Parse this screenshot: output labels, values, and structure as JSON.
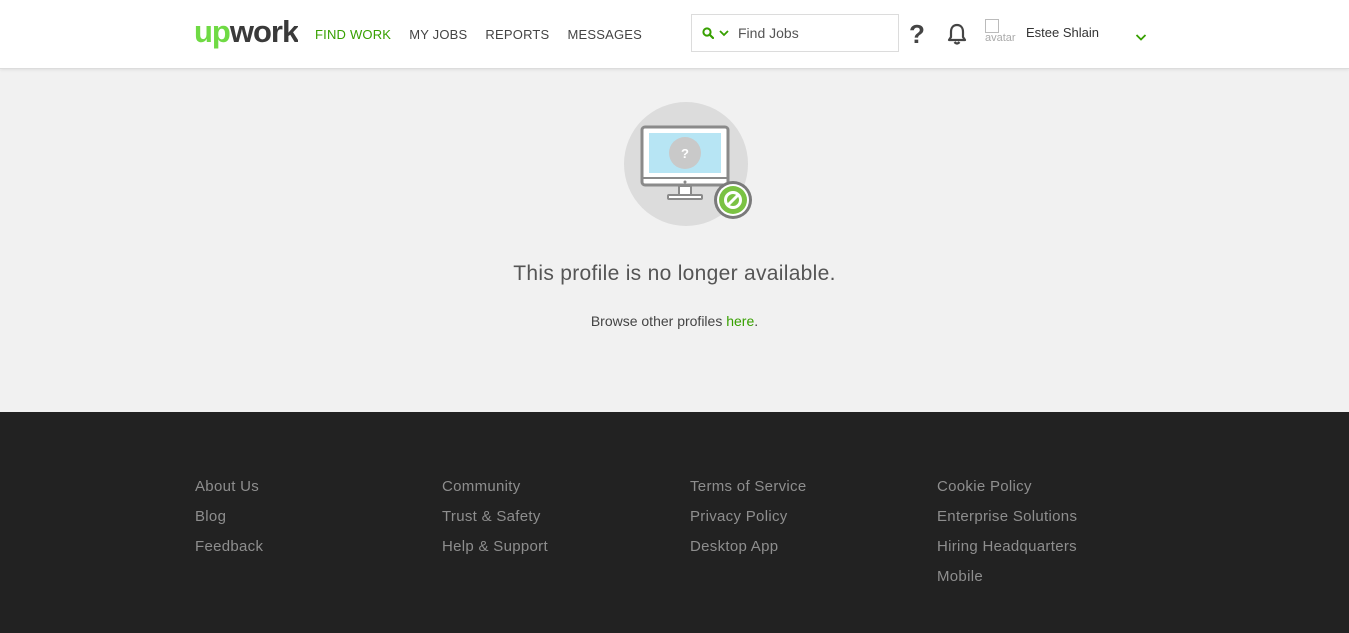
{
  "brand": {
    "logo_text": "upwork",
    "accent": "#37a000"
  },
  "nav": {
    "items": [
      {
        "label": "FIND WORK",
        "active": true
      },
      {
        "label": "MY JOBS"
      },
      {
        "label": "REPORTS"
      },
      {
        "label": "MESSAGES"
      }
    ]
  },
  "search": {
    "placeholder": "Find Jobs",
    "value": "",
    "icon": "search-icon"
  },
  "header": {
    "help_label": "?",
    "avatar_alt": "avatar",
    "user_name": "Estee Shlain"
  },
  "main": {
    "message": "This profile is no longer available.",
    "browse_prefix": "Browse other profiles ",
    "browse_link": "here",
    "browse_suffix": "."
  },
  "footer": {
    "columns": [
      [
        "About Us",
        "Blog",
        "Feedback"
      ],
      [
        "Community",
        "Trust & Safety",
        "Help & Support"
      ],
      [
        "Terms of Service",
        "Privacy Policy",
        "Desktop App"
      ],
      [
        "Cookie Policy",
        "Enterprise Solutions",
        "Hiring Headquarters",
        "Mobile"
      ]
    ]
  }
}
